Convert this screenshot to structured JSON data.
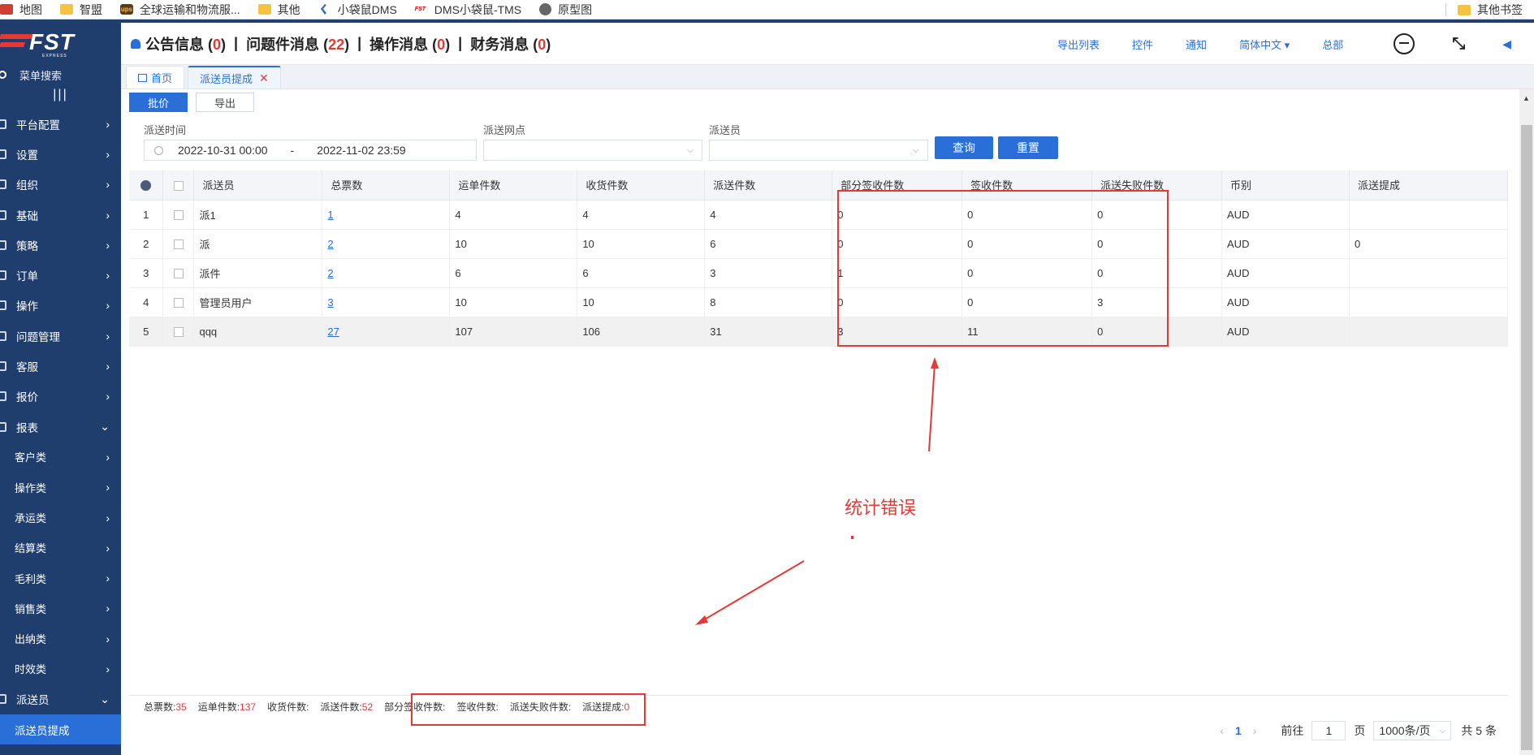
{
  "bookmarks": [
    {
      "label": "地图",
      "icon": "map-icon"
    },
    {
      "label": "智盟",
      "icon": "folder-icon"
    },
    {
      "label": "全球运输和物流服...",
      "icon": "ups-icon"
    },
    {
      "label": "其他",
      "icon": "folder-icon"
    },
    {
      "label": "小袋鼠DMS",
      "icon": "kite-icon"
    },
    {
      "label": "DMS小袋鼠-TMS",
      "icon": "fst-icon"
    },
    {
      "label": "原型图",
      "icon": "globe-icon"
    }
  ],
  "bookmarks_right": "其他书签",
  "sidebar": {
    "search": "菜单搜索",
    "collapse": "|||",
    "items": [
      {
        "label": "平台配置",
        "chev": "›"
      },
      {
        "label": "设置",
        "chev": "›"
      },
      {
        "label": "组织",
        "chev": "›"
      },
      {
        "label": "基础",
        "chev": "›"
      },
      {
        "label": "策略",
        "chev": "›"
      },
      {
        "label": "订单",
        "chev": "›"
      },
      {
        "label": "操作",
        "chev": "›"
      },
      {
        "label": "问题管理",
        "chev": "›"
      },
      {
        "label": "客服",
        "chev": "›"
      },
      {
        "label": "报价",
        "chev": "›"
      },
      {
        "label": "报表",
        "chev": "⌄"
      },
      {
        "label": "客户类",
        "chev": "›"
      },
      {
        "label": "操作类",
        "chev": "›"
      },
      {
        "label": "承运类",
        "chev": "›"
      },
      {
        "label": "结算类",
        "chev": "›"
      },
      {
        "label": "毛利类",
        "chev": "›"
      },
      {
        "label": "销售类",
        "chev": "›"
      },
      {
        "label": "出纳类",
        "chev": "›"
      },
      {
        "label": "时效类",
        "chev": "›"
      },
      {
        "label": "派送员",
        "chev": "⌄"
      },
      {
        "label": "派送员提成",
        "chev": ""
      }
    ]
  },
  "header": {
    "notices": [
      {
        "label": "公告信息",
        "count": "0"
      },
      {
        "label": "问题件消息",
        "count": "22"
      },
      {
        "label": "操作消息",
        "count": "0"
      },
      {
        "label": "财务消息",
        "count": "0"
      }
    ],
    "links": [
      "导出列表",
      "控件",
      "通知",
      "简体中文 ▾",
      "总部"
    ]
  },
  "tabs": [
    {
      "label": "首页"
    },
    {
      "label": "派送员提成"
    }
  ],
  "toolbar": {
    "price": "批价",
    "export": "导出"
  },
  "filters": {
    "time_label": "派送时间",
    "time_start": "2022-10-31 00:00",
    "time_sep": "-",
    "time_end": "2022-11-02 23:59",
    "site_label": "派送网点",
    "courier_label": "派送员",
    "query": "查询",
    "reset": "重置"
  },
  "table": {
    "columns": [
      "派送员",
      "总票数",
      "运单件数",
      "收货件数",
      "派送件数",
      "部分签收件数",
      "签收件数",
      "派送失败件数",
      "币别",
      "派送提成"
    ],
    "rows": [
      {
        "idx": "1",
        "courier": "派1",
        "tickets": "1",
        "waybill": "4",
        "received": "4",
        "delivered": "4",
        "partial": "0",
        "signed": "0",
        "failed": "0",
        "currency": "AUD",
        "commission": ""
      },
      {
        "idx": "2",
        "courier": "派",
        "tickets": "2",
        "waybill": "10",
        "received": "10",
        "delivered": "6",
        "partial": "0",
        "signed": "0",
        "failed": "0",
        "currency": "AUD",
        "commission": "0"
      },
      {
        "idx": "3",
        "courier": "派件",
        "tickets": "2",
        "waybill": "6",
        "received": "6",
        "delivered": "3",
        "partial": "1",
        "signed": "0",
        "failed": "0",
        "currency": "AUD",
        "commission": ""
      },
      {
        "idx": "4",
        "courier": "管理员用户",
        "tickets": "3",
        "waybill": "10",
        "received": "10",
        "delivered": "8",
        "partial": "0",
        "signed": "0",
        "failed": "3",
        "currency": "AUD",
        "commission": ""
      },
      {
        "idx": "5",
        "courier": "qqq",
        "tickets": "27",
        "waybill": "107",
        "received": "106",
        "delivered": "31",
        "partial": "3",
        "signed": "11",
        "failed": "0",
        "currency": "AUD",
        "commission": ""
      }
    ]
  },
  "summary": [
    {
      "label": "总票数:",
      "value": "35"
    },
    {
      "label": "运单件数:",
      "value": "137"
    },
    {
      "label": "收货件数:",
      "value": ""
    },
    {
      "label": "派送件数:",
      "value": "52"
    },
    {
      "label": "部分签收件数:",
      "value": ""
    },
    {
      "label": "签收件数:",
      "value": ""
    },
    {
      "label": "派送失败件数:",
      "value": ""
    },
    {
      "label": "派送提成:",
      "value": "0"
    }
  ],
  "pager": {
    "prev": "‹",
    "current": "1",
    "next": "›",
    "goto_prefix": "前往",
    "goto_value": "1",
    "goto_suffix": "页",
    "page_size": "1000条/页",
    "total": "共 5 条"
  },
  "annotation": {
    "text": "统计错误",
    "color": "#e53935"
  },
  "colors": {
    "sidebar": "#1f3e6e",
    "accent": "#2a6fd8",
    "alert": "#e53935"
  }
}
